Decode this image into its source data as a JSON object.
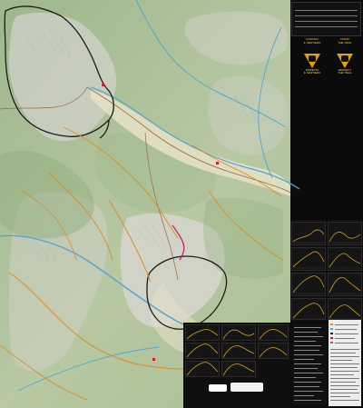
{
  "map": {
    "title": "",
    "colors": {
      "base": "#b9c8a6",
      "forest": "#97b287",
      "rock": "#d2d1cb",
      "valley": "#e8e2c8",
      "river": "#4fa6d8",
      "trail": "#e28a1e",
      "road": "#9a6a3a",
      "boundary": "#1b1b1b",
      "highlight": "#c2185b"
    }
  },
  "hud": {
    "icons": [
      "legend-icon"
    ]
  },
  "respect": {
    "left": {
      "line1": "CONOSCI",
      "line2": "IL SENTIERO",
      "line3": "RISPETTA",
      "line4": "IL SENTIERO"
    },
    "right": {
      "line1": "KNOW",
      "line2": "THE TRAIL",
      "line3": "RESPECT",
      "line4": "THE TRAIL"
    }
  },
  "profiles": {
    "count": 12
  },
  "bottom_panel": {
    "count": 8
  },
  "legend": {
    "count": 34
  }
}
